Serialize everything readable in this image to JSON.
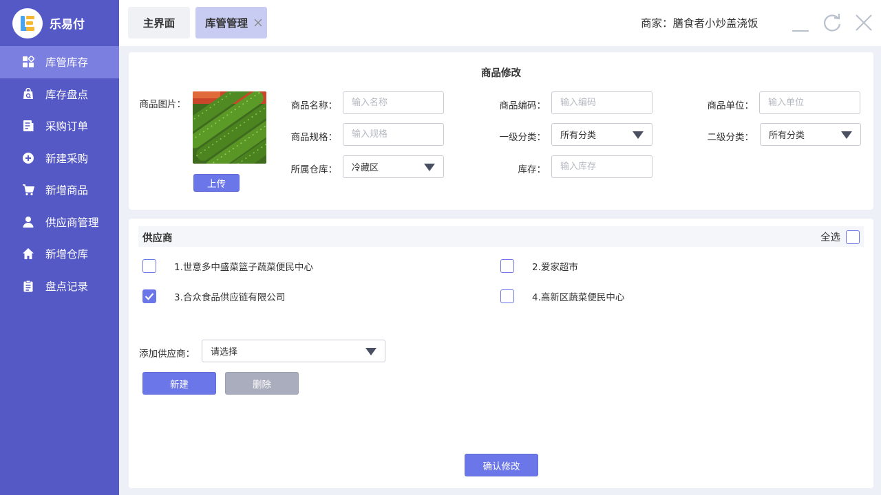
{
  "app": {
    "name": "乐易付"
  },
  "sidebar": {
    "items": [
      {
        "label": "库管库存",
        "icon": "grid-icon",
        "active": true
      },
      {
        "label": "库存盘点",
        "icon": "inventory-check-icon"
      },
      {
        "label": "采购订单",
        "icon": "order-list-icon"
      },
      {
        "label": "新建采购",
        "icon": "plus-circle-icon"
      },
      {
        "label": "新增商品",
        "icon": "cart-icon"
      },
      {
        "label": "供应商管理",
        "icon": "user-icon"
      },
      {
        "label": "新增仓库",
        "icon": "home-icon"
      },
      {
        "label": "盘点记录",
        "icon": "clipboard-icon"
      }
    ]
  },
  "topbar": {
    "tabs": [
      {
        "label": "主界面"
      },
      {
        "label": "库管管理",
        "closable": true
      }
    ],
    "merchant": "商家：膳食者小炒盖浇饭"
  },
  "product_form": {
    "title": "商品修改",
    "image_label": "商品图片：",
    "upload_label": "上传",
    "name": {
      "label": "商品名称：",
      "placeholder": "输入名称"
    },
    "code": {
      "label": "商品编码：",
      "placeholder": "输入编码"
    },
    "unit": {
      "label": "商品单位：",
      "placeholder": "输入单位"
    },
    "spec": {
      "label": "商品规格：",
      "placeholder": "输入规格"
    },
    "category1": {
      "label": "一级分类：",
      "value": "所有分类"
    },
    "category2": {
      "label": "二级分类：",
      "value": "所有分类"
    },
    "warehouse": {
      "label": "所属仓库：",
      "value": "冷藏区"
    },
    "stock": {
      "label": "库存：",
      "placeholder": "输入库存"
    }
  },
  "suppliers": {
    "title": "供应商",
    "select_all_label": "全选",
    "items": [
      {
        "label": "1.世意多中盛菜篮子蔬菜便民中心",
        "checked": false
      },
      {
        "label": "2.爱家超市",
        "checked": false
      },
      {
        "label": "3.合众食品供应链有限公司",
        "checked": true
      },
      {
        "label": "4.高新区蔬菜便民中心",
        "checked": false
      }
    ],
    "add_label": "添加供应商：",
    "add_placeholder": "请选择",
    "new_label": "新建",
    "delete_label": "删除"
  },
  "confirm_label": "确认修改",
  "colors": {
    "sidebar": "#5559c6",
    "sidebar_active": "#7b80e0",
    "primary": "#6b76e8",
    "gray_button": "#a9adbd",
    "tab_active": "#c8ccf3"
  }
}
